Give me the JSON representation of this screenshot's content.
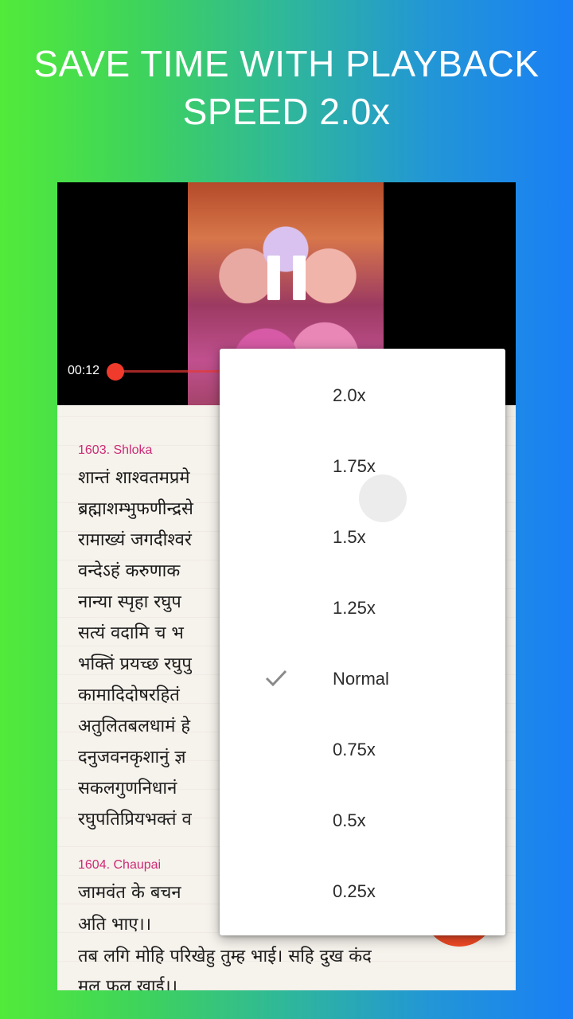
{
  "headline": {
    "line1": "SAVE TIME WITH PLAYBACK",
    "line2": "SPEED 2.0x"
  },
  "player": {
    "current_time": "00:12",
    "progress_fraction": 0.05
  },
  "verses": [
    {
      "header": "1603. Shloka",
      "lines": [
        "शान्तं शाश्वतमप्रमे",
        "ब्रह्माशम्भुफणीन्द्रसे",
        "रामाख्यं जगदीश्वरं",
        "वन्देऽहं करुणाक",
        "नान्या स्पृहा रघुप",
        "सत्यं वदामि च भ",
        "भक्तिं प्रयच्छ रघुपु",
        "कामादिदोषरहितं",
        "अतुलितबलधामं हे",
        "दनुजवनकृशानुं ज्ञ",
        "सकलगुणनिधानं",
        "रघुपतिप्रियभक्तं व"
      ]
    },
    {
      "header": "1604. Chaupai",
      "lines": [
        "जामवंत के बचन",
        "अति भाए।।",
        "तब लगि मोहि परिखेहु तुम्ह भाई। सहि दुख कंद",
        "मूल फल खाई।।"
      ]
    }
  ],
  "speed_menu": {
    "selected": "Normal",
    "options": [
      "2.0x",
      "1.75x",
      "1.5x",
      "1.25x",
      "Normal",
      "0.75x",
      "0.5x",
      "0.25x"
    ]
  },
  "colors": {
    "accent": "#f03a2c",
    "verse_header": "#cc2a76"
  },
  "icons": {
    "pause": "pause-icon",
    "check": "check-icon"
  }
}
